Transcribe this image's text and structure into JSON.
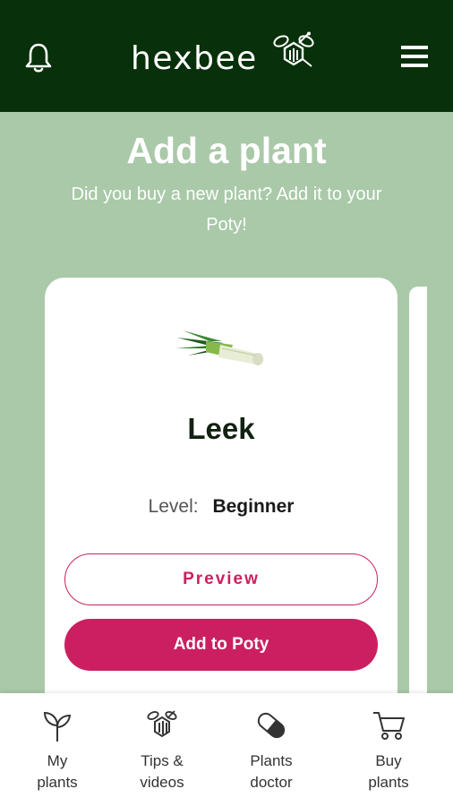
{
  "header": {
    "brand": "hexbee",
    "icons": {
      "notifications": "bell-icon",
      "menu": "hamburger-menu-icon",
      "logo": "bee-hexagon-logo"
    }
  },
  "hero": {
    "title": "Add a plant",
    "subtitle": "Did you buy a new plant?  Add it to your Poty!"
  },
  "card": {
    "plant_name": "Leek",
    "level_label": "Level:",
    "level_value": "Beginner",
    "preview_label": "Preview",
    "add_label": "Add to Poty"
  },
  "bottom_nav": {
    "items": [
      {
        "label": "My\nplants",
        "icon": "sprout-icon"
      },
      {
        "label": "Tips &\nvideos",
        "icon": "bee-icon"
      },
      {
        "label": "Plants\ndoctor",
        "icon": "pill-icon"
      },
      {
        "label": "Buy\nplants",
        "icon": "cart-icon"
      }
    ]
  },
  "colors": {
    "header_bg": "#08300a",
    "page_bg": "#a9c9a8",
    "accent": "#cc1f61",
    "text_dark": "#122112"
  }
}
